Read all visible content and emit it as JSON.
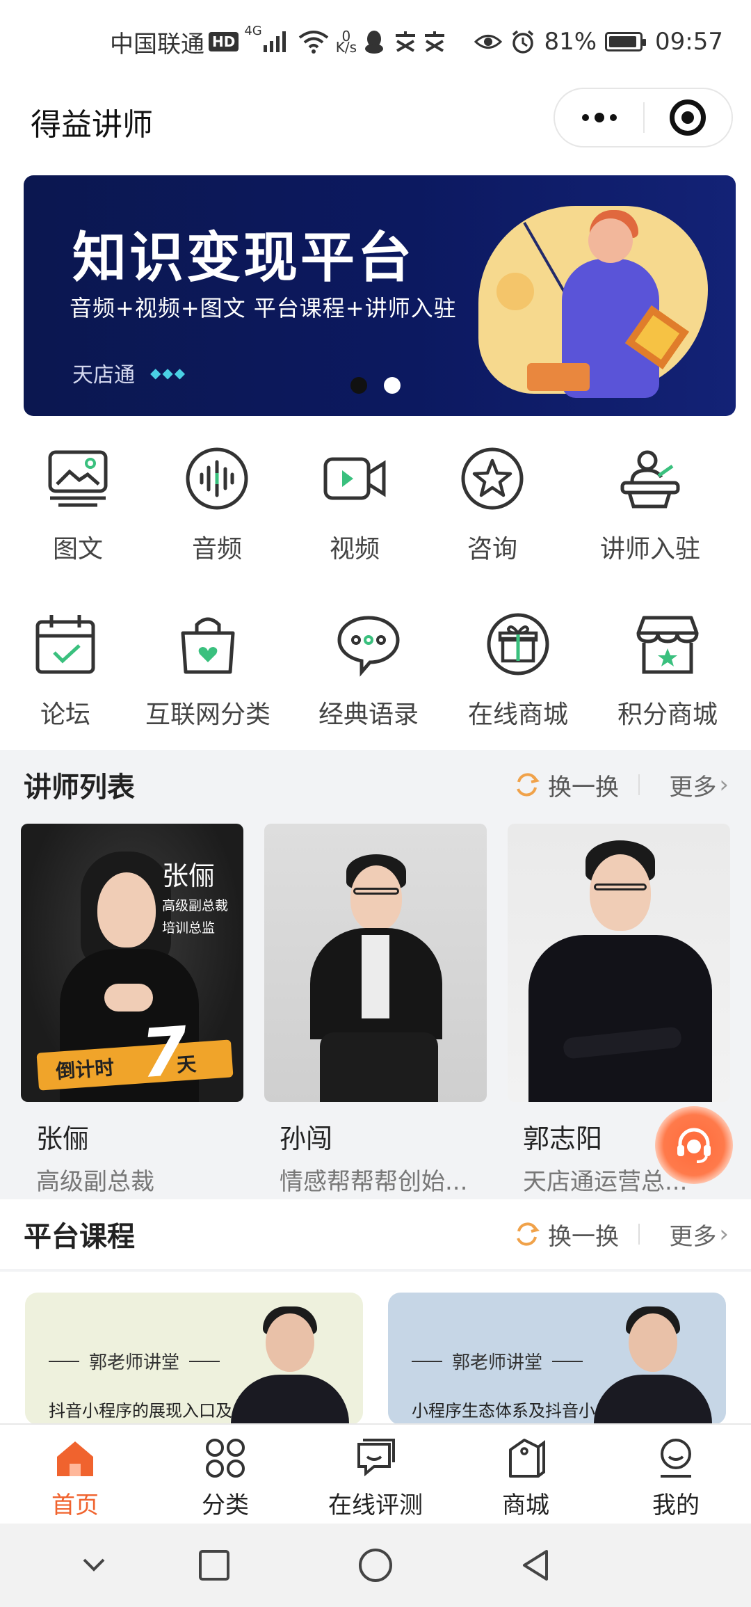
{
  "status_bar": {
    "carrier": "中国联通",
    "hd": "HD",
    "network": "4G",
    "speed_value": "0",
    "speed_unit": "K/s",
    "battery": "81%",
    "time": "09:57"
  },
  "header": {
    "title": "得益讲师"
  },
  "banner": {
    "title": "知识变现平台",
    "subtitle": "音频+视频+图文   平台课程+讲师入驻",
    "brand": "天店通",
    "dots": "◆◆◆",
    "page_count": 2,
    "current_page": 1
  },
  "menu_row1": [
    {
      "label": "图文",
      "icon": "image-text-icon"
    },
    {
      "label": "音频",
      "icon": "audio-icon"
    },
    {
      "label": "视频",
      "icon": "video-icon"
    },
    {
      "label": "咨询",
      "icon": "consult-star-icon"
    },
    {
      "label": "讲师入驻",
      "icon": "lecturer-podium-icon"
    }
  ],
  "menu_row2": [
    {
      "label": "论坛",
      "icon": "calendar-check-icon"
    },
    {
      "label": "互联网分类",
      "icon": "shopping-bag-heart-icon"
    },
    {
      "label": "经典语录",
      "icon": "chat-bubble-icon"
    },
    {
      "label": "在线商城",
      "icon": "gift-icon"
    },
    {
      "label": "积分商城",
      "icon": "store-star-icon"
    }
  ],
  "lecturers_section": {
    "heading": "讲师列表",
    "swap_label": "换一换",
    "more_label": "更多",
    "items": [
      {
        "name": "张俪",
        "title": "高级副总裁",
        "poster_name": "张俪",
        "poster_line1": "高级副总裁",
        "poster_line2": "培训总监",
        "countdown_left": "倒计时",
        "countdown_num": "7",
        "countdown_right": "天"
      },
      {
        "name": "孙闯",
        "title": "情感帮帮帮创始..."
      },
      {
        "name": "郭志阳",
        "title": "天店通运营总..."
      }
    ]
  },
  "courses_section": {
    "heading": "平台课程",
    "swap_label": "换一换",
    "more_label": "更多",
    "items": [
      {
        "brand": "郭老师讲堂",
        "text": "抖音小程序的展现入口及视频挂在方式讲解",
        "bg": "#eef1dd"
      },
      {
        "brand": "郭老师讲堂",
        "text": "小程序生态体系及抖音小程序定位",
        "bg": "#c6d6e6"
      }
    ]
  },
  "tab_bar": [
    {
      "label": "首页",
      "icon": "home-icon",
      "active": true
    },
    {
      "label": "分类",
      "icon": "category-icon",
      "active": false
    },
    {
      "label": "在线评测",
      "icon": "assessment-chat-icon",
      "active": false
    },
    {
      "label": "商城",
      "icon": "mall-tag-icon",
      "active": false
    },
    {
      "label": "我的",
      "icon": "profile-icon",
      "active": false
    }
  ],
  "colors": {
    "accent": "#f0632e",
    "banner_bg": "#0c1960",
    "section_bg": "#f2f3f5"
  }
}
